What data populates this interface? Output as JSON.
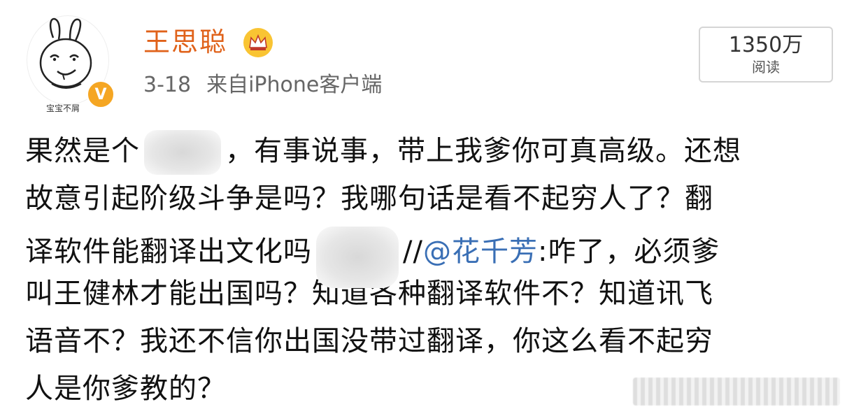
{
  "header": {
    "username": "王思聪",
    "date": "3-18",
    "source": "来自iPhone客户端",
    "avatar_caption": "宝宝不屑",
    "verified_badge": "V"
  },
  "read_box": {
    "count": "1350万",
    "label": "阅读"
  },
  "post": {
    "line1_a": "果然是个",
    "line1_b": "，有事说事，带上我爹你可真高级。还想",
    "line2": "故意引起阶级斗争是吗？我哪句话是看不起穷人了？翻",
    "line3_a": "译软件能翻译出文化吗",
    "line3_b": "//",
    "line3_mention": "@花千芳",
    "line3_c": ":咋了，必须爹",
    "line4": "叫王健林才能出国吗？知道各种翻译软件不？知道讯飞",
    "line5": "语音不？我还不信你出国没带过翻译，你这么看不起穷",
    "line6": "人是你爹教的？"
  },
  "colors": {
    "username": "#e0621a",
    "mention": "#3a6fb5",
    "verified": "#f5a623",
    "crown": "#f9c433"
  },
  "icons": {
    "verified": "verified-v-icon",
    "crown": "crown-icon",
    "avatar": "rabbit-cartoon-avatar"
  }
}
